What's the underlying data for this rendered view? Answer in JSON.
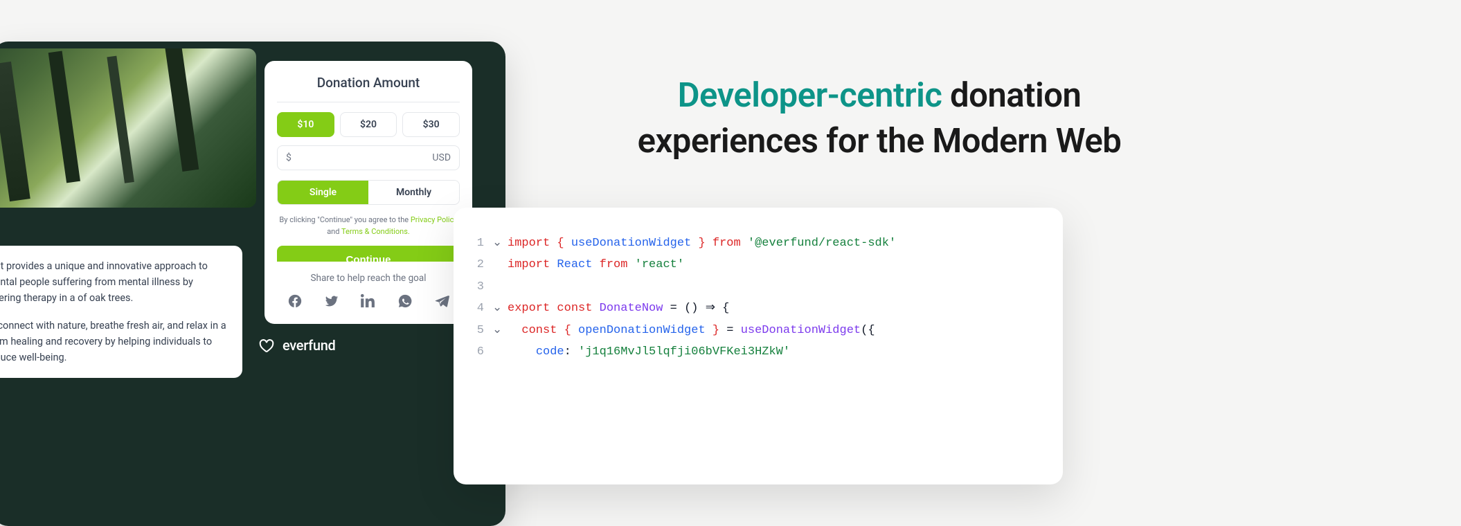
{
  "headline": {
    "accent": "Developer-centric",
    "rest1": " donation",
    "line2": "experiences for the Modern Web"
  },
  "widget": {
    "desc": {
      "p1": "that provides a unique and innovative approach to mental people suffering from mental illness by offering therapy in a of oak trees.",
      "p2": "to connect with nature, breathe fresh air, and relax in a calm healing and recovery by helping individuals to reduce well-being."
    },
    "donate": {
      "title": "Donation Amount",
      "amounts": [
        "$10",
        "$20",
        "$30"
      ],
      "active_amount_index": 0,
      "custom_prefix": "$",
      "custom_currency": "USD",
      "freq": [
        "Single",
        "Monthly"
      ],
      "active_freq_index": 0,
      "legal_prefix": "By clicking \"Continue\" you agree to the ",
      "legal_privacy": "Privacy Policy",
      "legal_and": " and ",
      "legal_terms": "Terms & Conditions.",
      "continue": "Continue"
    },
    "share": {
      "title": "Share to help reach the goal"
    },
    "brand": "everfund"
  },
  "code": {
    "lines": [
      {
        "n": 1,
        "fold": "v",
        "tokens": [
          [
            "kw",
            "import"
          ],
          [
            "plain",
            " "
          ],
          [
            "punc",
            "{ "
          ],
          [
            "id",
            "useDonationWidget"
          ],
          [
            "punc",
            " }"
          ],
          [
            "plain",
            " "
          ],
          [
            "from",
            "from"
          ],
          [
            "plain",
            " "
          ],
          [
            "str",
            "'@everfund/react-sdk'"
          ]
        ]
      },
      {
        "n": 2,
        "fold": "",
        "tokens": [
          [
            "kw",
            "import"
          ],
          [
            "plain",
            " "
          ],
          [
            "id",
            "React"
          ],
          [
            "plain",
            " "
          ],
          [
            "from",
            "from"
          ],
          [
            "plain",
            " "
          ],
          [
            "str",
            "'react'"
          ]
        ]
      },
      {
        "n": 3,
        "fold": "",
        "tokens": []
      },
      {
        "n": 4,
        "fold": "v",
        "tokens": [
          [
            "export",
            "export"
          ],
          [
            "plain",
            " "
          ],
          [
            "const",
            "const"
          ],
          [
            "plain",
            " "
          ],
          [
            "func",
            "DonateNow"
          ],
          [
            "plain",
            " = () "
          ],
          [
            "arrow",
            "⇒"
          ],
          [
            "plain",
            " {"
          ]
        ]
      },
      {
        "n": 5,
        "fold": "v",
        "tokens": [
          [
            "plain",
            "  "
          ],
          [
            "const",
            "const"
          ],
          [
            "plain",
            " "
          ],
          [
            "punc",
            "{ "
          ],
          [
            "id",
            "openDonationWidget"
          ],
          [
            "punc",
            " }"
          ],
          [
            "plain",
            " = "
          ],
          [
            "func",
            "useDonationWidget"
          ],
          [
            "plain",
            "({"
          ]
        ]
      },
      {
        "n": 6,
        "fold": "",
        "tokens": [
          [
            "plain",
            "    "
          ],
          [
            "id",
            "code"
          ],
          [
            "plain",
            ": "
          ],
          [
            "str",
            "'j1q16MvJl5lqfji06bVFKei3HZkW'"
          ]
        ]
      }
    ]
  }
}
